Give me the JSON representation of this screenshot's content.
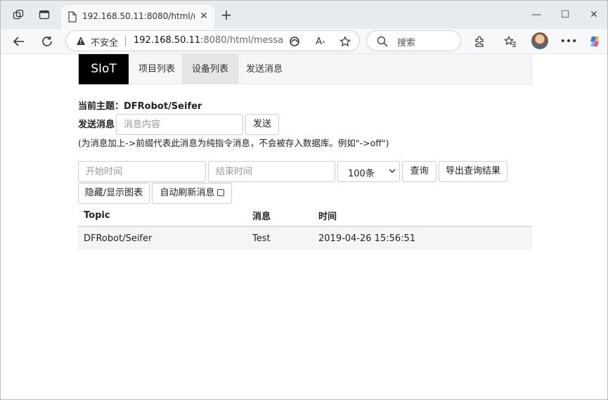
{
  "browser": {
    "tab_title": "192.168.50.11:8080/html/messages.html",
    "address": {
      "insecure_label": "不安全",
      "url_host": "192.168.50.11",
      "url_rest": ":8080/html/messages..."
    },
    "search_placeholder": "搜索",
    "icons": {
      "workspaces": "workspaces-icon",
      "tab_actions": "tab-actions-icon",
      "reload": "reload-icon",
      "back": "back-arrow-icon"
    }
  },
  "page": {
    "nav": {
      "brand": "SIoT",
      "items": [
        {
          "label": "项目列表",
          "active": false
        },
        {
          "label": "设备列表",
          "active": true
        },
        {
          "label": "发送消息",
          "active": false
        }
      ]
    },
    "subject": "当前主题：DFRobot/Seifer",
    "send": {
      "label": "发送消息",
      "input_placeholder": "消息内容",
      "button": "发送"
    },
    "hint": "(为消息加上->前缀代表此消息为纯指令消息，不会被存入数据库。例如\"->off\")",
    "query": {
      "start_placeholder": "开始时间",
      "end_placeholder": "结束时间",
      "limit_selected": "100条",
      "query_button": "查询",
      "export_button": "导出查询结果",
      "toggle_chart_button": "隐藏/显示图表",
      "auto_refresh_label": "自动刷新消息"
    },
    "table": {
      "headers": [
        "Topic",
        "消息",
        "时间"
      ],
      "rows": [
        {
          "topic": "DFRobot/Seifer",
          "message": "Test",
          "time": "2019-04-26 15:56:51"
        }
      ]
    }
  }
}
